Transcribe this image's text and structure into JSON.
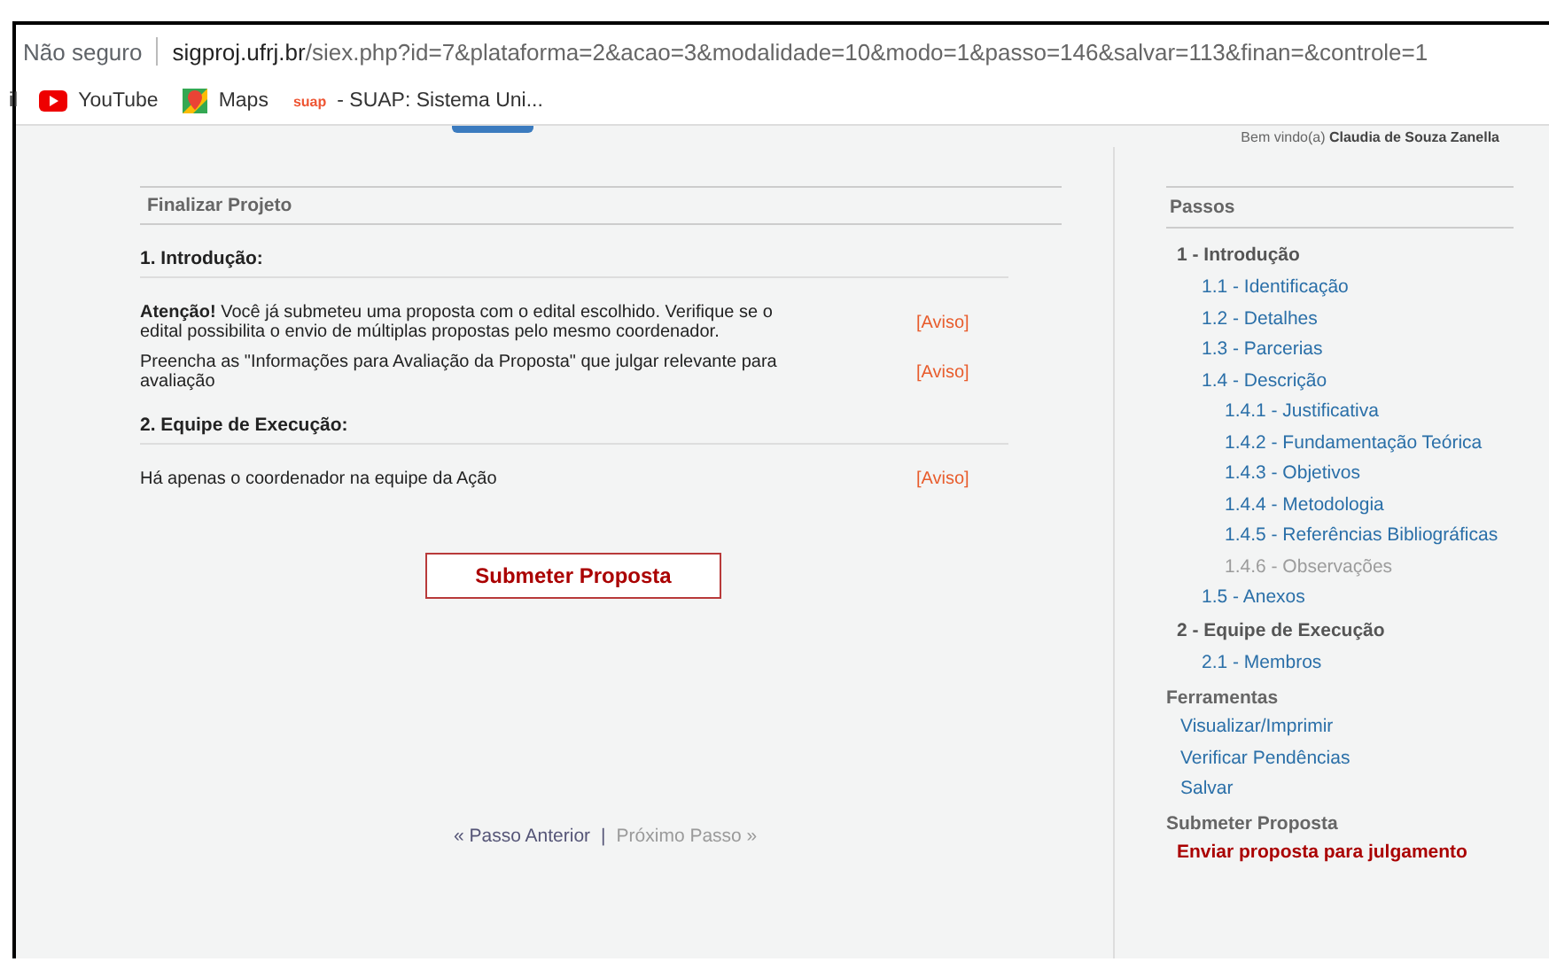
{
  "browser": {
    "security": "Não seguro",
    "url_host": "sigproj.ufrj.br",
    "url_path": "/siex.php?id=7&plataforma=2&acao=3&modalidade=10&modo=1&passo=146&salvar=113&finan=&controle=1"
  },
  "bookmarks": [
    {
      "label": "il",
      "kind": "cut"
    },
    {
      "label": "YouTube",
      "kind": "youtube"
    },
    {
      "label": "Maps",
      "kind": "maps"
    },
    {
      "label": "- SUAP: Sistema Uni...",
      "kind": "suap",
      "icon_text": "suap"
    }
  ],
  "header": {
    "welcome": "Bem vindo(a)",
    "user": "Claudia de Souza Zanella"
  },
  "main": {
    "title": "Finalizar Projeto",
    "sections": [
      {
        "heading": "1. Introdução:",
        "items": [
          {
            "text": "**Atenção!** Você já submeteu uma proposta com o edital escolhido. Verifique se o edital possibilita o envio de múltiplas propostas pelo mesmo coordenador.",
            "link": "[Aviso]"
          },
          {
            "text": "Preencha as \"Informações para Avaliação da Proposta\" que julgar relevante para avaliação",
            "link": "[Aviso]"
          }
        ]
      },
      {
        "heading": "2. Equipe de Execução:",
        "items": [
          {
            "text": "Há apenas o coordenador na equipe da Ação",
            "link": "[Aviso]"
          }
        ]
      }
    ],
    "submit_button": "Submeter Proposta",
    "nav": {
      "previous": {
        "label": "« Passo Anterior",
        "disabled": false
      },
      "separator": "|",
      "next": {
        "label": "Próximo Passo »",
        "disabled": true
      }
    }
  },
  "sidebar": {
    "title": "Passos",
    "steps": [
      {
        "label": "1 - Introdução",
        "disabled": false,
        "children": [
          {
            "label": "1.1 - Identificação",
            "disabled": false
          },
          {
            "label": "1.2 - Detalhes",
            "disabled": false
          },
          {
            "label": "1.3 - Parcerias",
            "disabled": false
          },
          {
            "label": "1.4 - Descrição",
            "disabled": false,
            "children": [
              {
                "label": "1.4.1 - Justificativa",
                "disabled": false
              },
              {
                "label": "1.4.2 - Fundamentação Teórica",
                "disabled": false
              },
              {
                "label": "1.4.3 - Objetivos",
                "disabled": false
              },
              {
                "label": "1.4.4 - Metodologia",
                "disabled": false
              },
              {
                "label": "1.4.5 - Referências Bibliográficas",
                "disabled": false
              },
              {
                "label": "1.4.6 - Observações",
                "disabled": true
              }
            ]
          },
          {
            "label": "1.5 - Anexos",
            "disabled": false
          }
        ]
      },
      {
        "label": "2 - Equipe de Execução",
        "disabled": false,
        "children": [
          {
            "label": "2.1 - Membros",
            "disabled": false
          }
        ]
      }
    ],
    "tools_title": "Ferramentas",
    "tools": [
      "Visualizar/Imprimir",
      "Verificar Pendências",
      "Salvar"
    ],
    "submit_title": "Submeter Proposta",
    "submit_link": "Enviar proposta para julgamento"
  }
}
